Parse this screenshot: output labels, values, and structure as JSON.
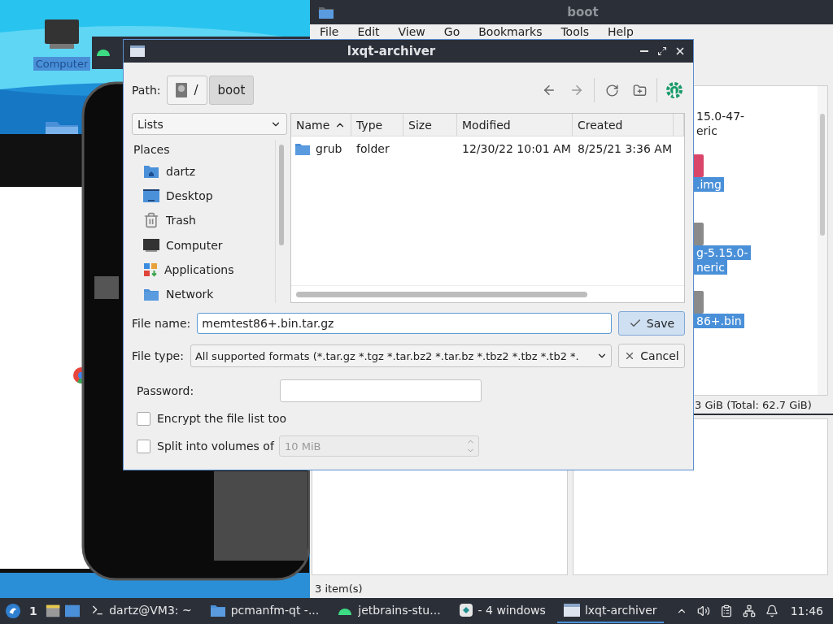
{
  "desktop": {
    "icons": [
      {
        "label": "Computer",
        "selected": true
      }
    ]
  },
  "file_manager": {
    "title": "boot",
    "menu": [
      "File",
      "Edit",
      "View",
      "Go",
      "Bookmarks",
      "Tools",
      "Help"
    ],
    "files": [
      {
        "lines": [
          "15.0-47-",
          "eric"
        ],
        "kind": "text",
        "selected": false
      },
      {
        "lines": [
          ".img"
        ],
        "selected": true
      },
      {
        "lines": [
          "g-5.15.0-",
          "neric"
        ],
        "kind": "file",
        "selected": true
      },
      {
        "lines": [
          "86+.bin"
        ],
        "kind": "file",
        "selected": true
      }
    ],
    "disk_status": "3 GiB (Total: 62.7 GiB)",
    "item_count": "3 item(s)"
  },
  "dialog": {
    "title": "lxqt-archiver",
    "path_label": "Path:",
    "path": [
      {
        "label": "/",
        "kind": "root",
        "selected": false
      },
      {
        "label": "boot",
        "kind": "folder",
        "selected": true
      }
    ],
    "places_view": "Lists",
    "places_heading": "Places",
    "places": [
      {
        "label": "dartz",
        "kind": "home"
      },
      {
        "label": "Desktop",
        "kind": "desktop"
      },
      {
        "label": "Trash",
        "kind": "trash"
      },
      {
        "label": "Computer",
        "kind": "computer"
      },
      {
        "label": "Applications",
        "kind": "apps"
      },
      {
        "label": "Network",
        "kind": "network"
      }
    ],
    "columns": [
      {
        "label": "Name",
        "sorted": true
      },
      {
        "label": "Type",
        "sorted": false
      },
      {
        "label": "Size",
        "sorted": false
      },
      {
        "label": "Modified",
        "sorted": false
      },
      {
        "label": "Created",
        "sorted": false
      }
    ],
    "rows": [
      {
        "name": "grub",
        "type": "folder",
        "modified": "12/30/22 10:01 AM",
        "created": "8/25/21 3:36 AM"
      }
    ],
    "file_name_label": "File name:",
    "file_name": "memtest86+.bin.tar.gz",
    "file_type_label": "File type:",
    "file_type": "All supported formats (*.tar.gz *.tgz *.tar.bz2 *.tar.bz *.tbz2 *.tbz *.tb2 *.",
    "save": "Save",
    "cancel": "Cancel",
    "password_label": "Password:",
    "encrypt": {
      "label": "Encrypt the file list too",
      "checked": false
    },
    "split": {
      "label": "Split into volumes of",
      "checked": false
    },
    "volume_size": {
      "value": "10 MiB",
      "disabled": true
    }
  },
  "taskbar": {
    "workspace": "1",
    "tasks": [
      {
        "label": "dartz@VM3: ~",
        "kind": "terminal",
        "selected": false
      },
      {
        "label": "pcmanfm-qt -...",
        "kind": "folder",
        "selected": false
      },
      {
        "label": "jetbrains-stu...",
        "kind": "android",
        "selected": false
      },
      {
        "label": "- 4 windows",
        "kind": "group",
        "selected": false
      },
      {
        "label": "lxqt-archiver",
        "kind": "window",
        "selected": true
      }
    ],
    "clock": "11:46"
  }
}
